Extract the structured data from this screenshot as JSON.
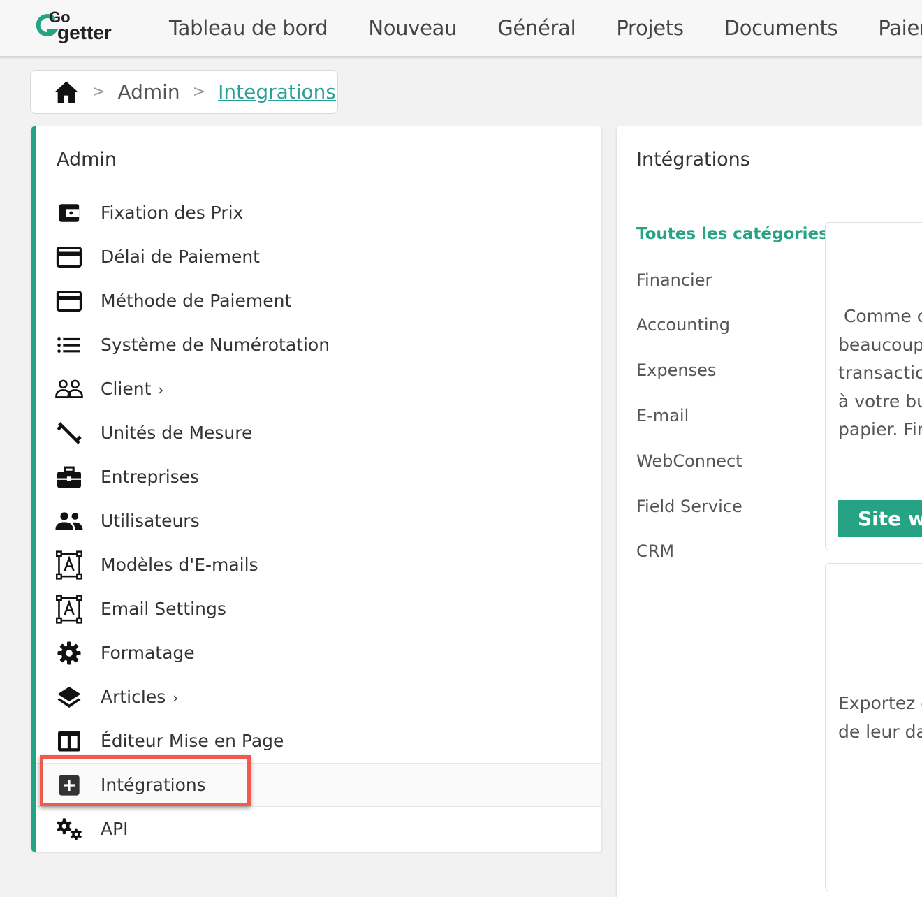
{
  "brand": {
    "logo_top": "Go",
    "logo_bottom": "getter",
    "accent": "#26a284",
    "link_color": "#2aa198",
    "highlight": "#ef5a4d"
  },
  "nav": [
    "Tableau de bord",
    "Nouveau",
    "Général",
    "Projets",
    "Documents",
    "Paieme"
  ],
  "breadcrumb": {
    "home_icon": "home-icon",
    "admin": "Admin",
    "current": "Integrations"
  },
  "admin": {
    "title": "Admin",
    "items": [
      {
        "label": "Fixation des Prix",
        "icon": "wallet-icon"
      },
      {
        "label": "Délai de Paiement",
        "icon": "credit-card-icon"
      },
      {
        "label": "Méthode de Paiement",
        "icon": "credit-card-icon"
      },
      {
        "label": "Système de Numérotation",
        "icon": "list-icon"
      },
      {
        "label": "Client",
        "icon": "users-outline-icon",
        "chevron": "›"
      },
      {
        "label": "Unités de Mesure",
        "icon": "ruler-icon"
      },
      {
        "label": "Entreprises",
        "icon": "briefcase-icon"
      },
      {
        "label": "Utilisateurs",
        "icon": "people-icon"
      },
      {
        "label": "Modèles d'E-mails",
        "icon": "text-template-icon"
      },
      {
        "label": "Email Settings",
        "icon": "text-template-icon"
      },
      {
        "label": "Formatage",
        "icon": "gear-icon"
      },
      {
        "label": "Articles",
        "icon": "layers-icon",
        "chevron": "›"
      },
      {
        "label": "Éditeur Mise en Page",
        "icon": "layout-icon"
      },
      {
        "label": "Intégrations",
        "icon": "plus-box-icon",
        "active": true
      },
      {
        "label": "API",
        "icon": "gears-icon"
      }
    ]
  },
  "integrations": {
    "title": "Intégrations",
    "categories": [
      "Toutes les catégories",
      "Financier",
      "Accounting",
      "Expenses",
      "E-mail",
      "WebConnect",
      "Field Service",
      "CRM"
    ],
    "card1_lines": " Comme c\nbeaucoup\ntransactio\nà votre bu\npapier. Fin",
    "card1_button": "Site we",
    "card2_lines": "Exportez e\nde leur dat"
  }
}
